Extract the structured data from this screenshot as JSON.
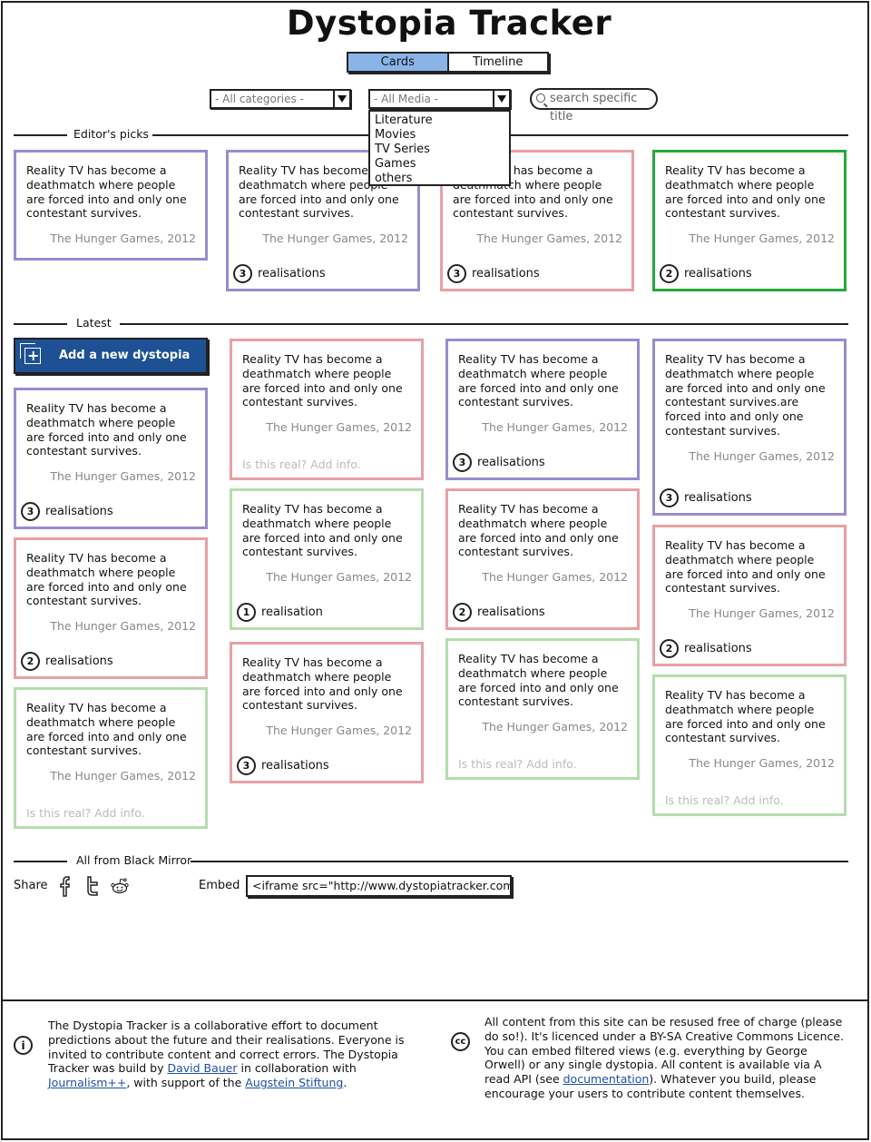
{
  "title": "Dystopia Tracker",
  "tabs": [
    {
      "label": "Cards",
      "active": true
    },
    {
      "label": "Timeline",
      "active": false
    }
  ],
  "filters": {
    "category": "- All categories -",
    "media": "- All Media -",
    "media_options": [
      "Literature",
      "Movies",
      "TV Series",
      "Games",
      "others"
    ],
    "search_placeholder": "search specific title"
  },
  "sections": {
    "editors_picks": "Editor's picks",
    "latest": "Latest",
    "all_from": "All from Black Mirror"
  },
  "quote": "Reality TV has become a deathmatch where people are forced into and only one contestant survives.",
  "quote_long": "Reality TV has become a deathmatch where people are forced into and only one contestant survives.are forced into and only one contestant survives.",
  "source": "The Hunger Games, 2012",
  "add_info": "Is this real? Add info.",
  "realisations_label": "realisations",
  "realisation_label": "realisation",
  "counts": {
    "one": "1",
    "two": "2",
    "three": "3"
  },
  "add_button": "Add a new dystopia",
  "share_label": "Share",
  "embed_label": "Embed",
  "embed_code": "<iframe src=\"http://www.dystopiatracker.com/....",
  "icons": [
    "facebook-icon",
    "twitter-icon",
    "reddit-icon",
    "info-icon",
    "creative-commons-icon",
    "add-dystopia-icon",
    "search-icon"
  ],
  "colors": {
    "purple": "#9a8bd0",
    "red": "#e8a0a3",
    "green": "#b5dcae",
    "dark_green": "#24a93b",
    "button_blue": "#1d5194",
    "tab_active": "#8ab4e8"
  },
  "footer": {
    "left": {
      "t1": "The Dystopia Tracker is a collaborative effort to document predictions about the future and their realisations. Everyone is invited to contribute content and correct errors. The Dystopia Tracker was build by ",
      "author": "David Bauer",
      "t2": " in collaboration with ",
      "partner": "Journalism++",
      "t3": ", with support of the ",
      "sponsor": "Augstein Stiftung",
      "t4": "."
    },
    "right": {
      "t1": "All content from this site can be resused free of charge (please do so!). It's licenced under a BY-SA Creative Commons Licence. You can embed filtered views (e.g. everything by George Orwell) or any single dystopia. All content is available via A read API (see ",
      "doc": "documentation",
      "t2": "). Whatever you build, please encourage your users to contribute content themselves."
    }
  }
}
